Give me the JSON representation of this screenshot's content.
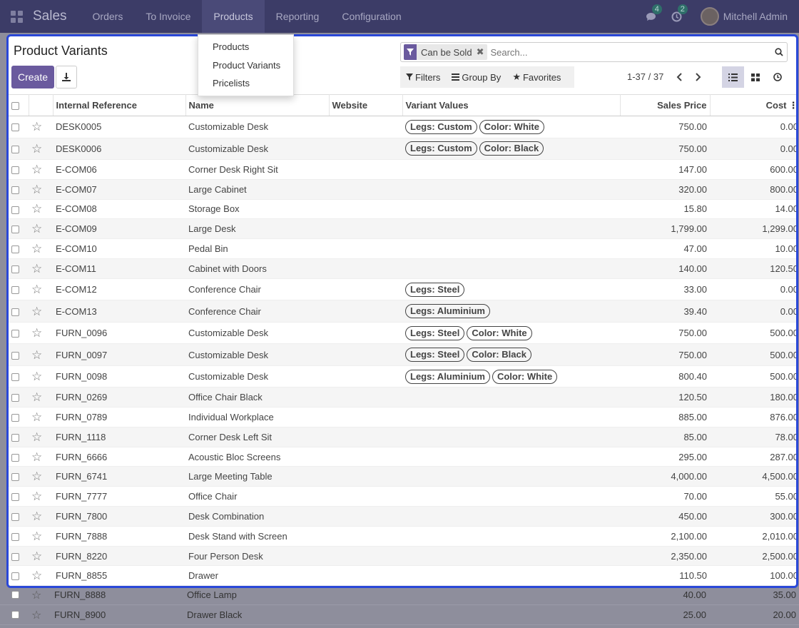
{
  "navbar": {
    "brand": "Sales",
    "menu": [
      "Orders",
      "To Invoice",
      "Products",
      "Reporting",
      "Configuration"
    ],
    "messages_count": "4",
    "activities_count": "2",
    "user_name": "Mitchell Admin"
  },
  "dropdown": {
    "items": [
      "Products",
      "Product Variants",
      "Pricelists"
    ]
  },
  "control_panel": {
    "title": "Product Variants",
    "create_label": "Create",
    "facet_label": "Can be Sold",
    "search_placeholder": "Search...",
    "filters_label": "Filters",
    "group_by_label": "Group By",
    "favorites_label": "Favorites",
    "pager": "1-37 / 37"
  },
  "table": {
    "headers": [
      "Internal Reference",
      "Name",
      "Website",
      "Variant Values",
      "Sales Price",
      "Cost"
    ],
    "rows": [
      {
        "ref": "DESK0005",
        "name": "Customizable Desk",
        "tags": [
          "Legs: Custom",
          "Color: White"
        ],
        "price": "750.00",
        "cost": "0.00"
      },
      {
        "ref": "DESK0006",
        "name": "Customizable Desk",
        "tags": [
          "Legs: Custom",
          "Color: Black"
        ],
        "price": "750.00",
        "cost": "0.00"
      },
      {
        "ref": "E-COM06",
        "name": "Corner Desk Right Sit",
        "tags": [],
        "price": "147.00",
        "cost": "600.00"
      },
      {
        "ref": "E-COM07",
        "name": "Large Cabinet",
        "tags": [],
        "price": "320.00",
        "cost": "800.00"
      },
      {
        "ref": "E-COM08",
        "name": "Storage Box",
        "tags": [],
        "price": "15.80",
        "cost": "14.00"
      },
      {
        "ref": "E-COM09",
        "name": "Large Desk",
        "tags": [],
        "price": "1,799.00",
        "cost": "1,299.00"
      },
      {
        "ref": "E-COM10",
        "name": "Pedal Bin",
        "tags": [],
        "price": "47.00",
        "cost": "10.00"
      },
      {
        "ref": "E-COM11",
        "name": "Cabinet with Doors",
        "tags": [],
        "price": "140.00",
        "cost": "120.50"
      },
      {
        "ref": "E-COM12",
        "name": "Conference Chair",
        "tags": [
          "Legs: Steel"
        ],
        "price": "33.00",
        "cost": "0.00"
      },
      {
        "ref": "E-COM13",
        "name": "Conference Chair",
        "tags": [
          "Legs: Aluminium"
        ],
        "price": "39.40",
        "cost": "0.00"
      },
      {
        "ref": "FURN_0096",
        "name": "Customizable Desk",
        "tags": [
          "Legs: Steel",
          "Color: White"
        ],
        "price": "750.00",
        "cost": "500.00"
      },
      {
        "ref": "FURN_0097",
        "name": "Customizable Desk",
        "tags": [
          "Legs: Steel",
          "Color: Black"
        ],
        "price": "750.00",
        "cost": "500.00"
      },
      {
        "ref": "FURN_0098",
        "name": "Customizable Desk",
        "tags": [
          "Legs: Aluminium",
          "Color: White"
        ],
        "price": "800.40",
        "cost": "500.00"
      },
      {
        "ref": "FURN_0269",
        "name": "Office Chair Black",
        "tags": [],
        "price": "120.50",
        "cost": "180.00"
      },
      {
        "ref": "FURN_0789",
        "name": "Individual Workplace",
        "tags": [],
        "price": "885.00",
        "cost": "876.00"
      },
      {
        "ref": "FURN_1118",
        "name": "Corner Desk Left Sit",
        "tags": [],
        "price": "85.00",
        "cost": "78.00"
      },
      {
        "ref": "FURN_6666",
        "name": "Acoustic Bloc Screens",
        "tags": [],
        "price": "295.00",
        "cost": "287.00"
      },
      {
        "ref": "FURN_6741",
        "name": "Large Meeting Table",
        "tags": [],
        "price": "4,000.00",
        "cost": "4,500.00"
      },
      {
        "ref": "FURN_7777",
        "name": "Office Chair",
        "tags": [],
        "price": "70.00",
        "cost": "55.00"
      },
      {
        "ref": "FURN_7800",
        "name": "Desk Combination",
        "tags": [],
        "price": "450.00",
        "cost": "300.00"
      },
      {
        "ref": "FURN_7888",
        "name": "Desk Stand with Screen",
        "tags": [],
        "price": "2,100.00",
        "cost": "2,010.00"
      },
      {
        "ref": "FURN_8220",
        "name": "Four Person Desk",
        "tags": [],
        "price": "2,350.00",
        "cost": "2,500.00"
      },
      {
        "ref": "FURN_8855",
        "name": "Drawer",
        "tags": [],
        "price": "110.50",
        "cost": "100.00"
      }
    ],
    "dim_rows": [
      {
        "ref": "FURN_8888",
        "name": "Office Lamp",
        "price": "40.00",
        "cost": "35.00"
      },
      {
        "ref": "FURN_8900",
        "name": "Drawer Black",
        "price": "25.00",
        "cost": "20.00"
      }
    ]
  },
  "colors": {
    "navbar": "#3c3c67",
    "primary": "#6a5a9e",
    "focus_border": "#2a48d8",
    "dim": "#8e8e9c"
  }
}
